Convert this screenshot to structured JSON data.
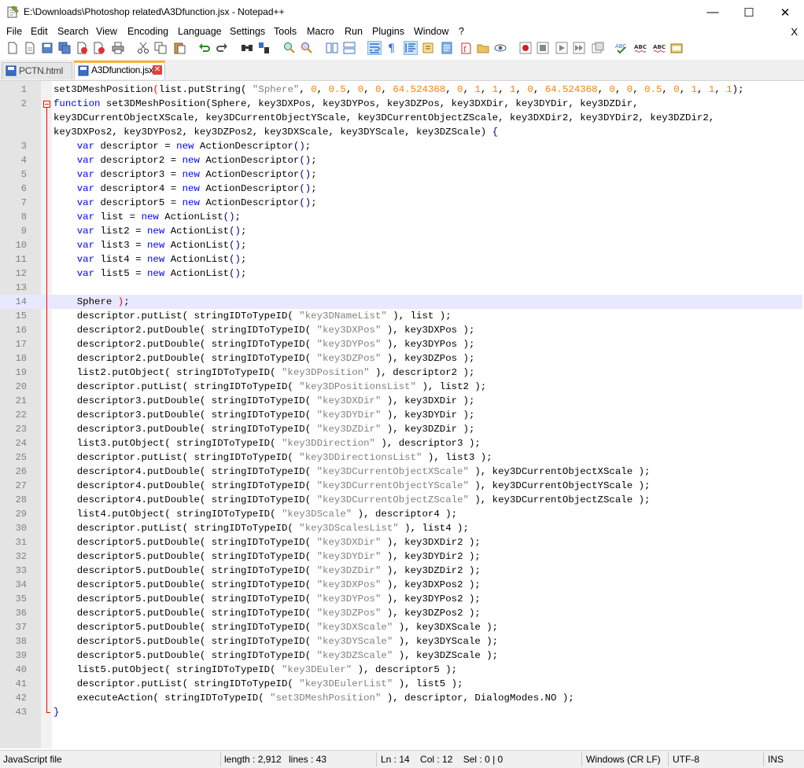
{
  "window": {
    "title": "E:\\Downloads\\Photoshop related\\A3Dfunction.jsx - Notepad++",
    "minimize": "—",
    "maximize": "☐",
    "close": "✕"
  },
  "menu": {
    "items": [
      "File",
      "Edit",
      "Search",
      "View",
      "Encoding",
      "Language",
      "Settings",
      "Tools",
      "Macro",
      "Run",
      "Plugins",
      "Window",
      "?"
    ],
    "close": "X"
  },
  "toolbar": {
    "icons": [
      "new-file-icon",
      "open-file-icon",
      "save-icon",
      "save-all-icon",
      "close-icon",
      "close-all-icon",
      "print-icon",
      "cut-icon",
      "copy-icon",
      "paste-icon",
      "undo-icon",
      "redo-icon",
      "find-icon",
      "replace-icon",
      "zoom-in-icon",
      "zoom-out-icon",
      "sync-vertical-icon",
      "sync-horizontal-icon",
      "word-wrap-icon",
      "show-all-chars-icon",
      "indent-guide-icon",
      "udl-icon",
      "doc-map-icon",
      "function-list-icon",
      "folder-workspace-icon",
      "monitoring-icon",
      "record-macro-icon",
      "stop-macro-icon",
      "play-macro-icon",
      "run-macro-multiple-icon",
      "save-macro-icon",
      "spellcheck-icon",
      "spellcheck-abc-icon",
      "spellcheck-abc2-icon",
      "notepad-plugin-icon"
    ]
  },
  "tabs": [
    {
      "label": "PCTN.html",
      "active": false
    },
    {
      "label": "A3Dfunction.jsx",
      "active": true
    }
  ],
  "editor": {
    "current_line": 14,
    "lines": [
      {
        "n": "1",
        "html": "set3DMeshPosition<span class=\"b\">(</span>list.putString( <span class=\"s\">\"Sphere\"</span>, <span class=\"n\">0</span>, <span class=\"n\">0.5</span>, <span class=\"n\">0</span>, <span class=\"n\">0</span>, <span class=\"n\">64.524368</span>, <span class=\"n\">0</span>, <span class=\"n\">1</span>, <span class=\"n\">1</span>, <span class=\"n\">1</span>, <span class=\"n\">0</span>, <span class=\"n\">64.524368</span>, <span class=\"n\">0</span>, <span class=\"n\">0</span>, <span class=\"n\">0.5</span>, <span class=\"n\">0</span>, <span class=\"n\">1</span>, <span class=\"n\">1</span>, <span class=\"n\">1</span>);"
      },
      {
        "n": "2",
        "html": "<span class=\"k\">function</span> set3DMeshPosition(Sphere, key3DXPos, key3DYPos, key3DZPos, key3DXDir, key3DYDir, key3DZDir,"
      },
      {
        "n": "",
        "html": "key3DCurrentObjectXScale, key3DCurrentObjectYScale, key3DCurrentObjectZScale, key3DXDir2, key3DYDir2, key3DZDir2,"
      },
      {
        "n": "",
        "html": "key3DXPos2, key3DYPos2, key3DZPos2, key3DXScale, key3DYScale, key3DZScale) <span class=\"o\">{</span>"
      },
      {
        "n": "3",
        "html": "    <span class=\"k\">var</span> descriptor = <span class=\"k\">new</span> ActionDescriptor<span class=\"o\">()</span>;"
      },
      {
        "n": "4",
        "html": "    <span class=\"k\">var</span> descriptor2 = <span class=\"k\">new</span> ActionDescriptor<span class=\"o\">()</span>;"
      },
      {
        "n": "5",
        "html": "    <span class=\"k\">var</span> descriptor3 = <span class=\"k\">new</span> ActionDescriptor<span class=\"o\">()</span>;"
      },
      {
        "n": "6",
        "html": "    <span class=\"k\">var</span> descriptor4 = <span class=\"k\">new</span> ActionDescriptor<span class=\"o\">()</span>;"
      },
      {
        "n": "7",
        "html": "    <span class=\"k\">var</span> descriptor5 = <span class=\"k\">new</span> ActionDescriptor<span class=\"o\">()</span>;"
      },
      {
        "n": "8",
        "html": "    <span class=\"k\">var</span> list = <span class=\"k\">new</span> ActionList<span class=\"o\">()</span>;"
      },
      {
        "n": "9",
        "html": "    <span class=\"k\">var</span> list2 = <span class=\"k\">new</span> ActionList<span class=\"o\">()</span>;"
      },
      {
        "n": "10",
        "html": "    <span class=\"k\">var</span> list3 = <span class=\"k\">new</span> ActionList<span class=\"o\">()</span>;"
      },
      {
        "n": "11",
        "html": "    <span class=\"k\">var</span> list4 = <span class=\"k\">new</span> ActionList<span class=\"o\">()</span>;"
      },
      {
        "n": "12",
        "html": "    <span class=\"k\">var</span> list5 = <span class=\"k\">new</span> ActionList<span class=\"o\">()</span>;"
      },
      {
        "n": "13",
        "html": ""
      },
      {
        "n": "14",
        "html": "    Sphere <span class=\"b\">)</span>;"
      },
      {
        "n": "15",
        "html": "    descriptor.putList( stringIDToTypeID( <span class=\"s\">\"key3DNameList\"</span> ), list );"
      },
      {
        "n": "16",
        "html": "    descriptor2.putDouble( stringIDToTypeID( <span class=\"s\">\"key3DXPos\"</span> ), key3DXPos );"
      },
      {
        "n": "17",
        "html": "    descriptor2.putDouble( stringIDToTypeID( <span class=\"s\">\"key3DYPos\"</span> ), key3DYPos );"
      },
      {
        "n": "18",
        "html": "    descriptor2.putDouble( stringIDToTypeID( <span class=\"s\">\"key3DZPos\"</span> ), key3DZPos );"
      },
      {
        "n": "19",
        "html": "    list2.putObject( stringIDToTypeID( <span class=\"s\">\"key3DPosition\"</span> ), descriptor2 );"
      },
      {
        "n": "20",
        "html": "    descriptor.putList( stringIDToTypeID( <span class=\"s\">\"key3DPositionsList\"</span> ), list2 );"
      },
      {
        "n": "21",
        "html": "    descriptor3.putDouble( stringIDToTypeID( <span class=\"s\">\"key3DXDir\"</span> ), key3DXDir );"
      },
      {
        "n": "22",
        "html": "    descriptor3.putDouble( stringIDToTypeID( <span class=\"s\">\"key3DYDir\"</span> ), key3DYDir );"
      },
      {
        "n": "23",
        "html": "    descriptor3.putDouble( stringIDToTypeID( <span class=\"s\">\"key3DZDir\"</span> ), key3DZDir );"
      },
      {
        "n": "24",
        "html": "    list3.putObject( stringIDToTypeID( <span class=\"s\">\"key3DDirection\"</span> ), descriptor3 );"
      },
      {
        "n": "25",
        "html": "    descriptor.putList( stringIDToTypeID( <span class=\"s\">\"key3DDirectionsList\"</span> ), list3 );"
      },
      {
        "n": "26",
        "html": "    descriptor4.putDouble( stringIDToTypeID( <span class=\"s\">\"key3DCurrentObjectXScale\"</span> ), key3DCurrentObjectXScale );"
      },
      {
        "n": "27",
        "html": "    descriptor4.putDouble( stringIDToTypeID( <span class=\"s\">\"key3DCurrentObjectYScale\"</span> ), key3DCurrentObjectYScale );"
      },
      {
        "n": "28",
        "html": "    descriptor4.putDouble( stringIDToTypeID( <span class=\"s\">\"key3DCurrentObjectZScale\"</span> ), key3DCurrentObjectZScale );"
      },
      {
        "n": "29",
        "html": "    list4.putObject( stringIDToTypeID( <span class=\"s\">\"key3DScale\"</span> ), descriptor4 );"
      },
      {
        "n": "30",
        "html": "    descriptor.putList( stringIDToTypeID( <span class=\"s\">\"key3DScalesList\"</span> ), list4 );"
      },
      {
        "n": "31",
        "html": "    descriptor5.putDouble( stringIDToTypeID( <span class=\"s\">\"key3DXDir\"</span> ), key3DXDir2 );"
      },
      {
        "n": "32",
        "html": "    descriptor5.putDouble( stringIDToTypeID( <span class=\"s\">\"key3DYDir\"</span> ), key3DYDir2 );"
      },
      {
        "n": "33",
        "html": "    descriptor5.putDouble( stringIDToTypeID( <span class=\"s\">\"key3DZDir\"</span> ), key3DZDir2 );"
      },
      {
        "n": "34",
        "html": "    descriptor5.putDouble( stringIDToTypeID( <span class=\"s\">\"key3DXPos\"</span> ), key3DXPos2 );"
      },
      {
        "n": "35",
        "html": "    descriptor5.putDouble( stringIDToTypeID( <span class=\"s\">\"key3DYPos\"</span> ), key3DYPos2 );"
      },
      {
        "n": "36",
        "html": "    descriptor5.putDouble( stringIDToTypeID( <span class=\"s\">\"key3DZPos\"</span> ), key3DZPos2 );"
      },
      {
        "n": "37",
        "html": "    descriptor5.putDouble( stringIDToTypeID( <span class=\"s\">\"key3DXScale\"</span> ), key3DXScale );"
      },
      {
        "n": "38",
        "html": "    descriptor5.putDouble( stringIDToTypeID( <span class=\"s\">\"key3DYScale\"</span> ), key3DYScale );"
      },
      {
        "n": "39",
        "html": "    descriptor5.putDouble( stringIDToTypeID( <span class=\"s\">\"key3DZScale\"</span> ), key3DZScale );"
      },
      {
        "n": "40",
        "html": "    list5.putObject( stringIDToTypeID( <span class=\"s\">\"key3DEuler\"</span> ), descriptor5 );"
      },
      {
        "n": "41",
        "html": "    descriptor.putList( stringIDToTypeID( <span class=\"s\">\"key3DEulerList\"</span> ), list5 );"
      },
      {
        "n": "42",
        "html": "    executeAction( stringIDToTypeID( <span class=\"s\">\"set3DMeshPosition\"</span> ), descriptor, DialogModes.NO );"
      },
      {
        "n": "43",
        "html": "<span class=\"o\">}</span>"
      }
    ]
  },
  "status": {
    "language": "JavaScript file",
    "length": "length : 2,912",
    "lines": "lines : 43",
    "position": "Ln : 14    Col : 12    Sel : 0 | 0",
    "eol": "Windows (CR LF)",
    "encoding": "UTF-8",
    "mode": "INS"
  }
}
